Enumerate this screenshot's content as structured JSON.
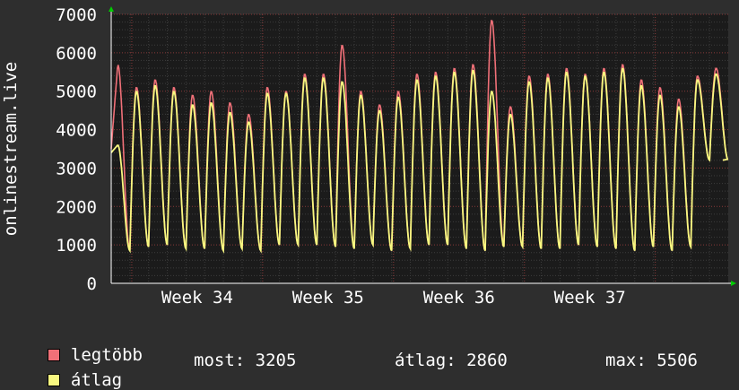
{
  "chart_data": {
    "type": "line",
    "ylabel": "onlinestream.live",
    "ylim": [
      0,
      7000
    ],
    "yticks": [
      "0",
      "1000",
      "2000",
      "3000",
      "4000",
      "5000",
      "6000",
      "7000"
    ],
    "xticks": [
      "Week 34",
      "Week 35",
      "Week 36",
      "Week 37"
    ],
    "grid": true,
    "series": [
      {
        "name": "legtöbb",
        "color": "#f07078",
        "daily_peaks": [
          5700,
          5100,
          5300,
          5100,
          4900,
          5000,
          4700,
          4400,
          5100,
          5000,
          5450,
          5450,
          6200,
          5000,
          4650,
          5000,
          5450,
          5500,
          5600,
          5700,
          6850,
          4600,
          5400,
          5450,
          5600,
          5450,
          5600,
          5700,
          5300,
          5100,
          4800,
          5400,
          5600
        ],
        "daily_troughs": [
          3500,
          850,
          950,
          1000,
          900,
          900,
          850,
          900,
          850,
          1000,
          1000,
          1000,
          950,
          900,
          1000,
          850,
          900,
          1000,
          1000,
          900,
          850,
          950,
          950,
          900,
          900,
          1000,
          950,
          900,
          850,
          950,
          850,
          950,
          3205
        ]
      },
      {
        "name": "átlag",
        "color": "#f8f880",
        "daily_peaks": [
          3600,
          5000,
          5150,
          5000,
          4650,
          4700,
          4450,
          4200,
          4950,
          4950,
          5350,
          5350,
          5250,
          4900,
          4500,
          4850,
          5300,
          5400,
          5500,
          5550,
          5000,
          4400,
          5250,
          5350,
          5500,
          5400,
          5500,
          5600,
          5150,
          4900,
          4600,
          5300,
          5450
        ],
        "daily_troughs": [
          3400,
          850,
          950,
          1000,
          900,
          900,
          850,
          900,
          850,
          1000,
          1000,
          1000,
          950,
          900,
          1000,
          850,
          900,
          1000,
          1000,
          900,
          850,
          950,
          950,
          900,
          900,
          1000,
          950,
          900,
          850,
          950,
          850,
          950,
          3205
        ]
      }
    ],
    "legend": [
      {
        "label": "legtöbb",
        "color": "#f07078"
      },
      {
        "label": "átlag",
        "color": "#f8f880"
      }
    ],
    "stats": {
      "most": "most: 3205",
      "atlag": "átlag: 2860",
      "max": "max: 5506"
    }
  }
}
